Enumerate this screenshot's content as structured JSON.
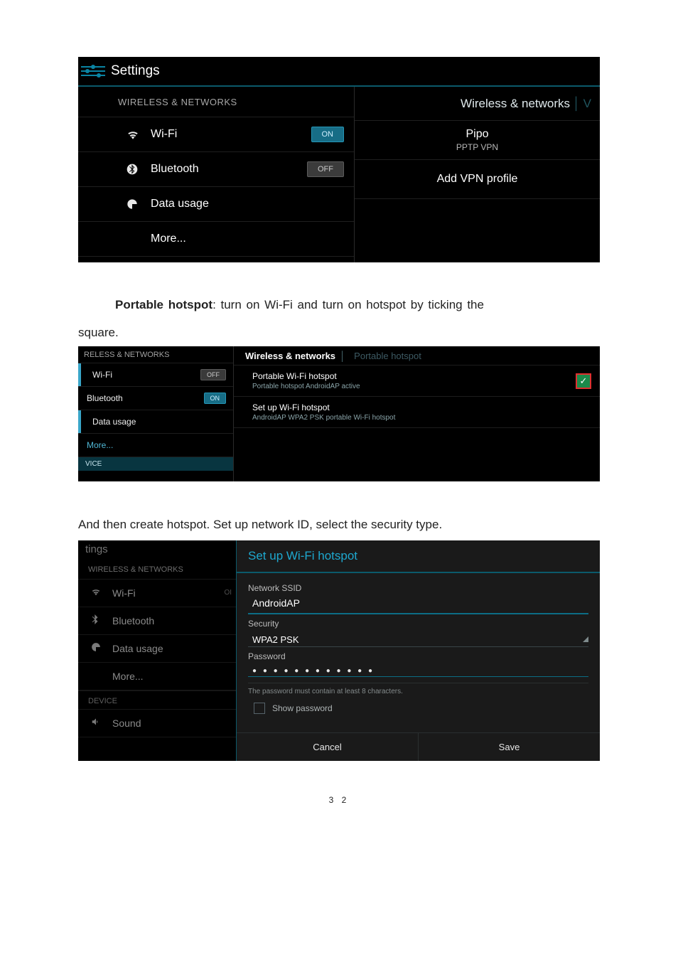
{
  "page_number": "3 2",
  "shot1": {
    "header_title": "Settings",
    "section": "WIRELESS & NETWORKS",
    "wifi": {
      "label": "Wi-Fi",
      "toggle": "ON"
    },
    "bluetooth": {
      "label": "Bluetooth",
      "toggle": "OFF"
    },
    "datausage": {
      "label": "Data usage"
    },
    "more": {
      "label": "More..."
    },
    "crumb": "Wireless & networks",
    "crumb_next": "V",
    "vpn": {
      "name": "Pipo",
      "type": "PPTP VPN"
    },
    "add_vpn": "Add VPN profile"
  },
  "para1_strong": "Portable hotspot",
  "para1_rest": ": turn on Wi-Fi and turn on hotspot by ticking the",
  "para1_cont": "square.",
  "shot2": {
    "section": "RELESS & NETWORKS",
    "wifi": {
      "label": "Wi-Fi",
      "toggle": "OFF"
    },
    "bluetooth": {
      "label": "Bluetooth",
      "toggle": "ON"
    },
    "datausage": "Data usage",
    "more": "More...",
    "vice": "VICE",
    "crumb": "Wireless & networks",
    "crumb_faded": "Portable hotspot",
    "row1": {
      "title": "Portable Wi-Fi hotspot",
      "sub": "Portable hotspot AndroidAP active",
      "check": "✓"
    },
    "row2": {
      "title": "Set up Wi-Fi hotspot",
      "sub": "AndroidAP WPA2 PSK portable Wi-Fi hotspot"
    }
  },
  "para2": "And then create hotspot. Set up network ID, select the security type.",
  "shot3": {
    "tings": "tings",
    "section": "WIRELESS & NETWORKS",
    "wifi": "Wi-Fi",
    "wifi_toggle": "OI",
    "bluetooth": "Bluetooth",
    "datausage": "Data usage",
    "more": "More...",
    "device": "DEVICE",
    "sound": "Sound",
    "dialog_title": "Set up Wi-Fi hotspot",
    "ssid_label": "Network SSID",
    "ssid_value": "AndroidAP",
    "security_label": "Security",
    "security_value": "WPA2 PSK",
    "password_label": "Password",
    "password_dots": "● ● ● ● ● ● ● ● ● ● ● ●",
    "password_hint": "The password must contain at least 8 characters.",
    "show_pw": "Show password",
    "cancel": "Cancel",
    "save": "Save"
  }
}
